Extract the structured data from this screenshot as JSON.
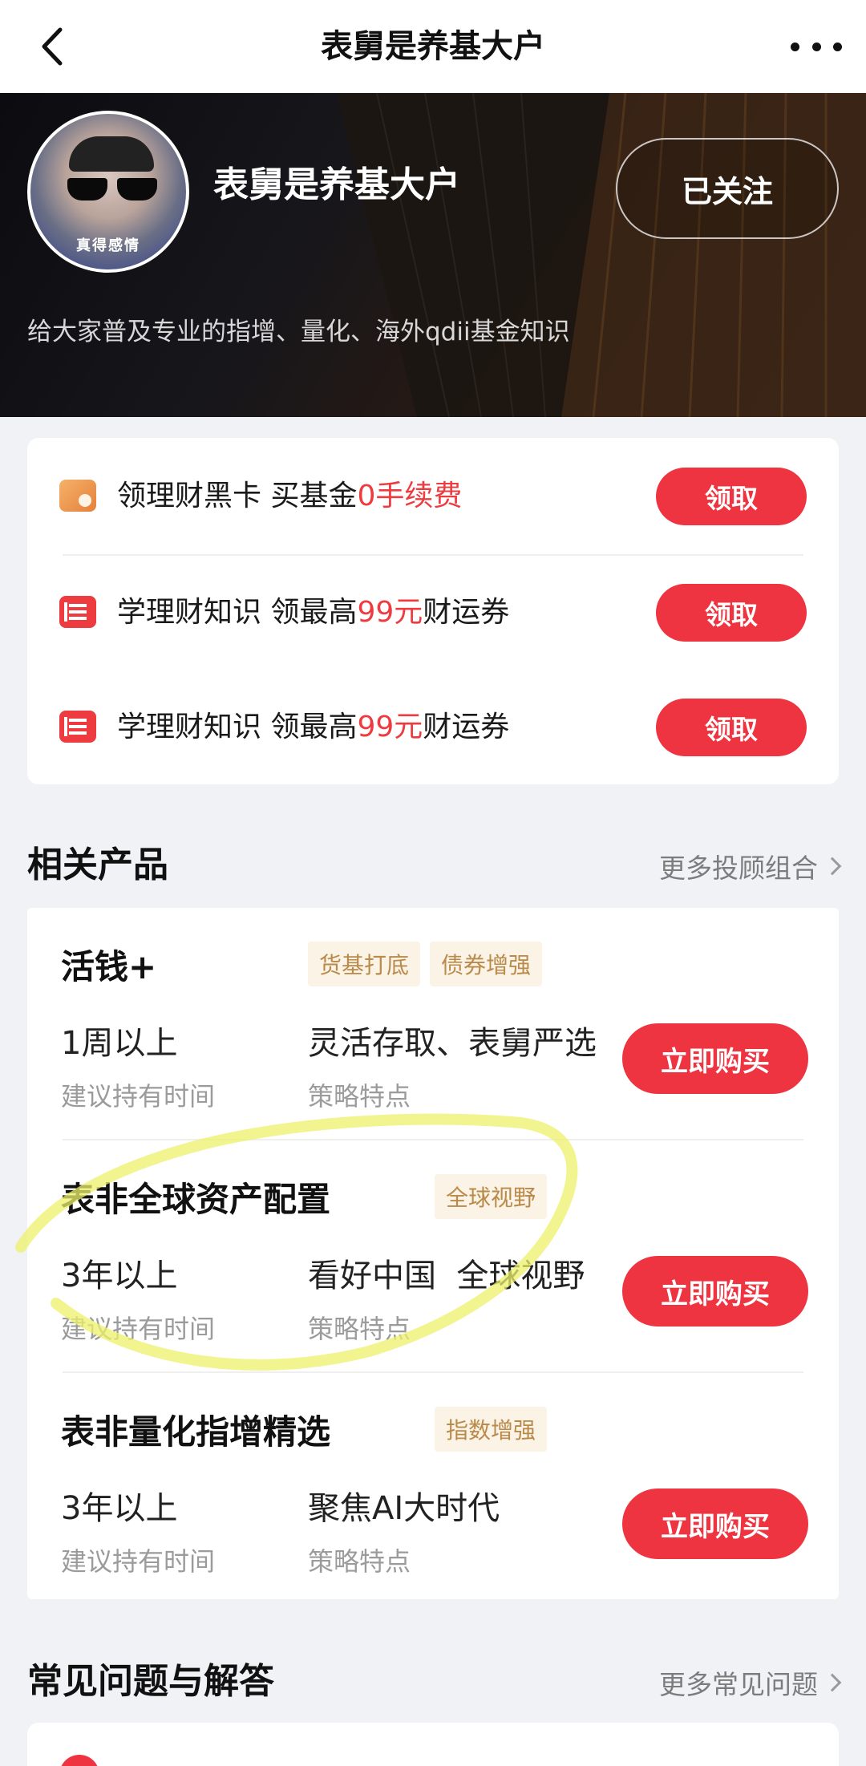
{
  "nav": {
    "title": "表舅是养基大户"
  },
  "profile": {
    "name": "表舅是养基大户",
    "avatar_caption": "真得感情",
    "follow_label": "已关注",
    "description": "给大家普及专业的指增、量化、海外qdii基金知识"
  },
  "promos": [
    {
      "icon": "member-card-icon",
      "text_before": "领理财黑卡 买基金",
      "highlight": "0手续费",
      "text_after": "",
      "button": "领取"
    },
    {
      "icon": "book-icon",
      "text_before": "学理财知识 领最高",
      "highlight": "99元",
      "text_after": "财运券",
      "button": "领取"
    },
    {
      "icon": "book-icon",
      "text_before": "学理财知识 领最高",
      "highlight": "99元",
      "text_after": "财运券",
      "button": "领取"
    }
  ],
  "products_section": {
    "title": "相关产品",
    "more": "更多投顾组合"
  },
  "products": [
    {
      "name": "活钱+",
      "tags": [
        "货基打底",
        "债券增强"
      ],
      "hold_value": "1周以上",
      "hold_label": "建议持有时间",
      "strategy_value": "灵活存取、表舅严选",
      "strategy_label": "策略特点",
      "button": "立即购买"
    },
    {
      "name": "表非全球资产配置",
      "tags": [
        "全球视野"
      ],
      "hold_value": "3年以上",
      "hold_label": "建议持有时间",
      "strategy_value": "看好中国  全球视野",
      "strategy_label": "策略特点",
      "button": "立即购买"
    },
    {
      "name": "表非量化指增精选",
      "tags": [
        "指数增强"
      ],
      "hold_value": "3年以上",
      "hold_label": "建议持有时间",
      "strategy_value": "聚焦AI大时代",
      "strategy_label": "策略特点",
      "button": "立即购买"
    }
  ],
  "faq_section": {
    "title": "常见问题与解答",
    "more": "更多常见问题"
  },
  "colors": {
    "accent_red": "#ee3440",
    "tag_bg": "#fbf3e6",
    "tag_text": "#b98a4a",
    "highlighter": "#eef06a"
  }
}
